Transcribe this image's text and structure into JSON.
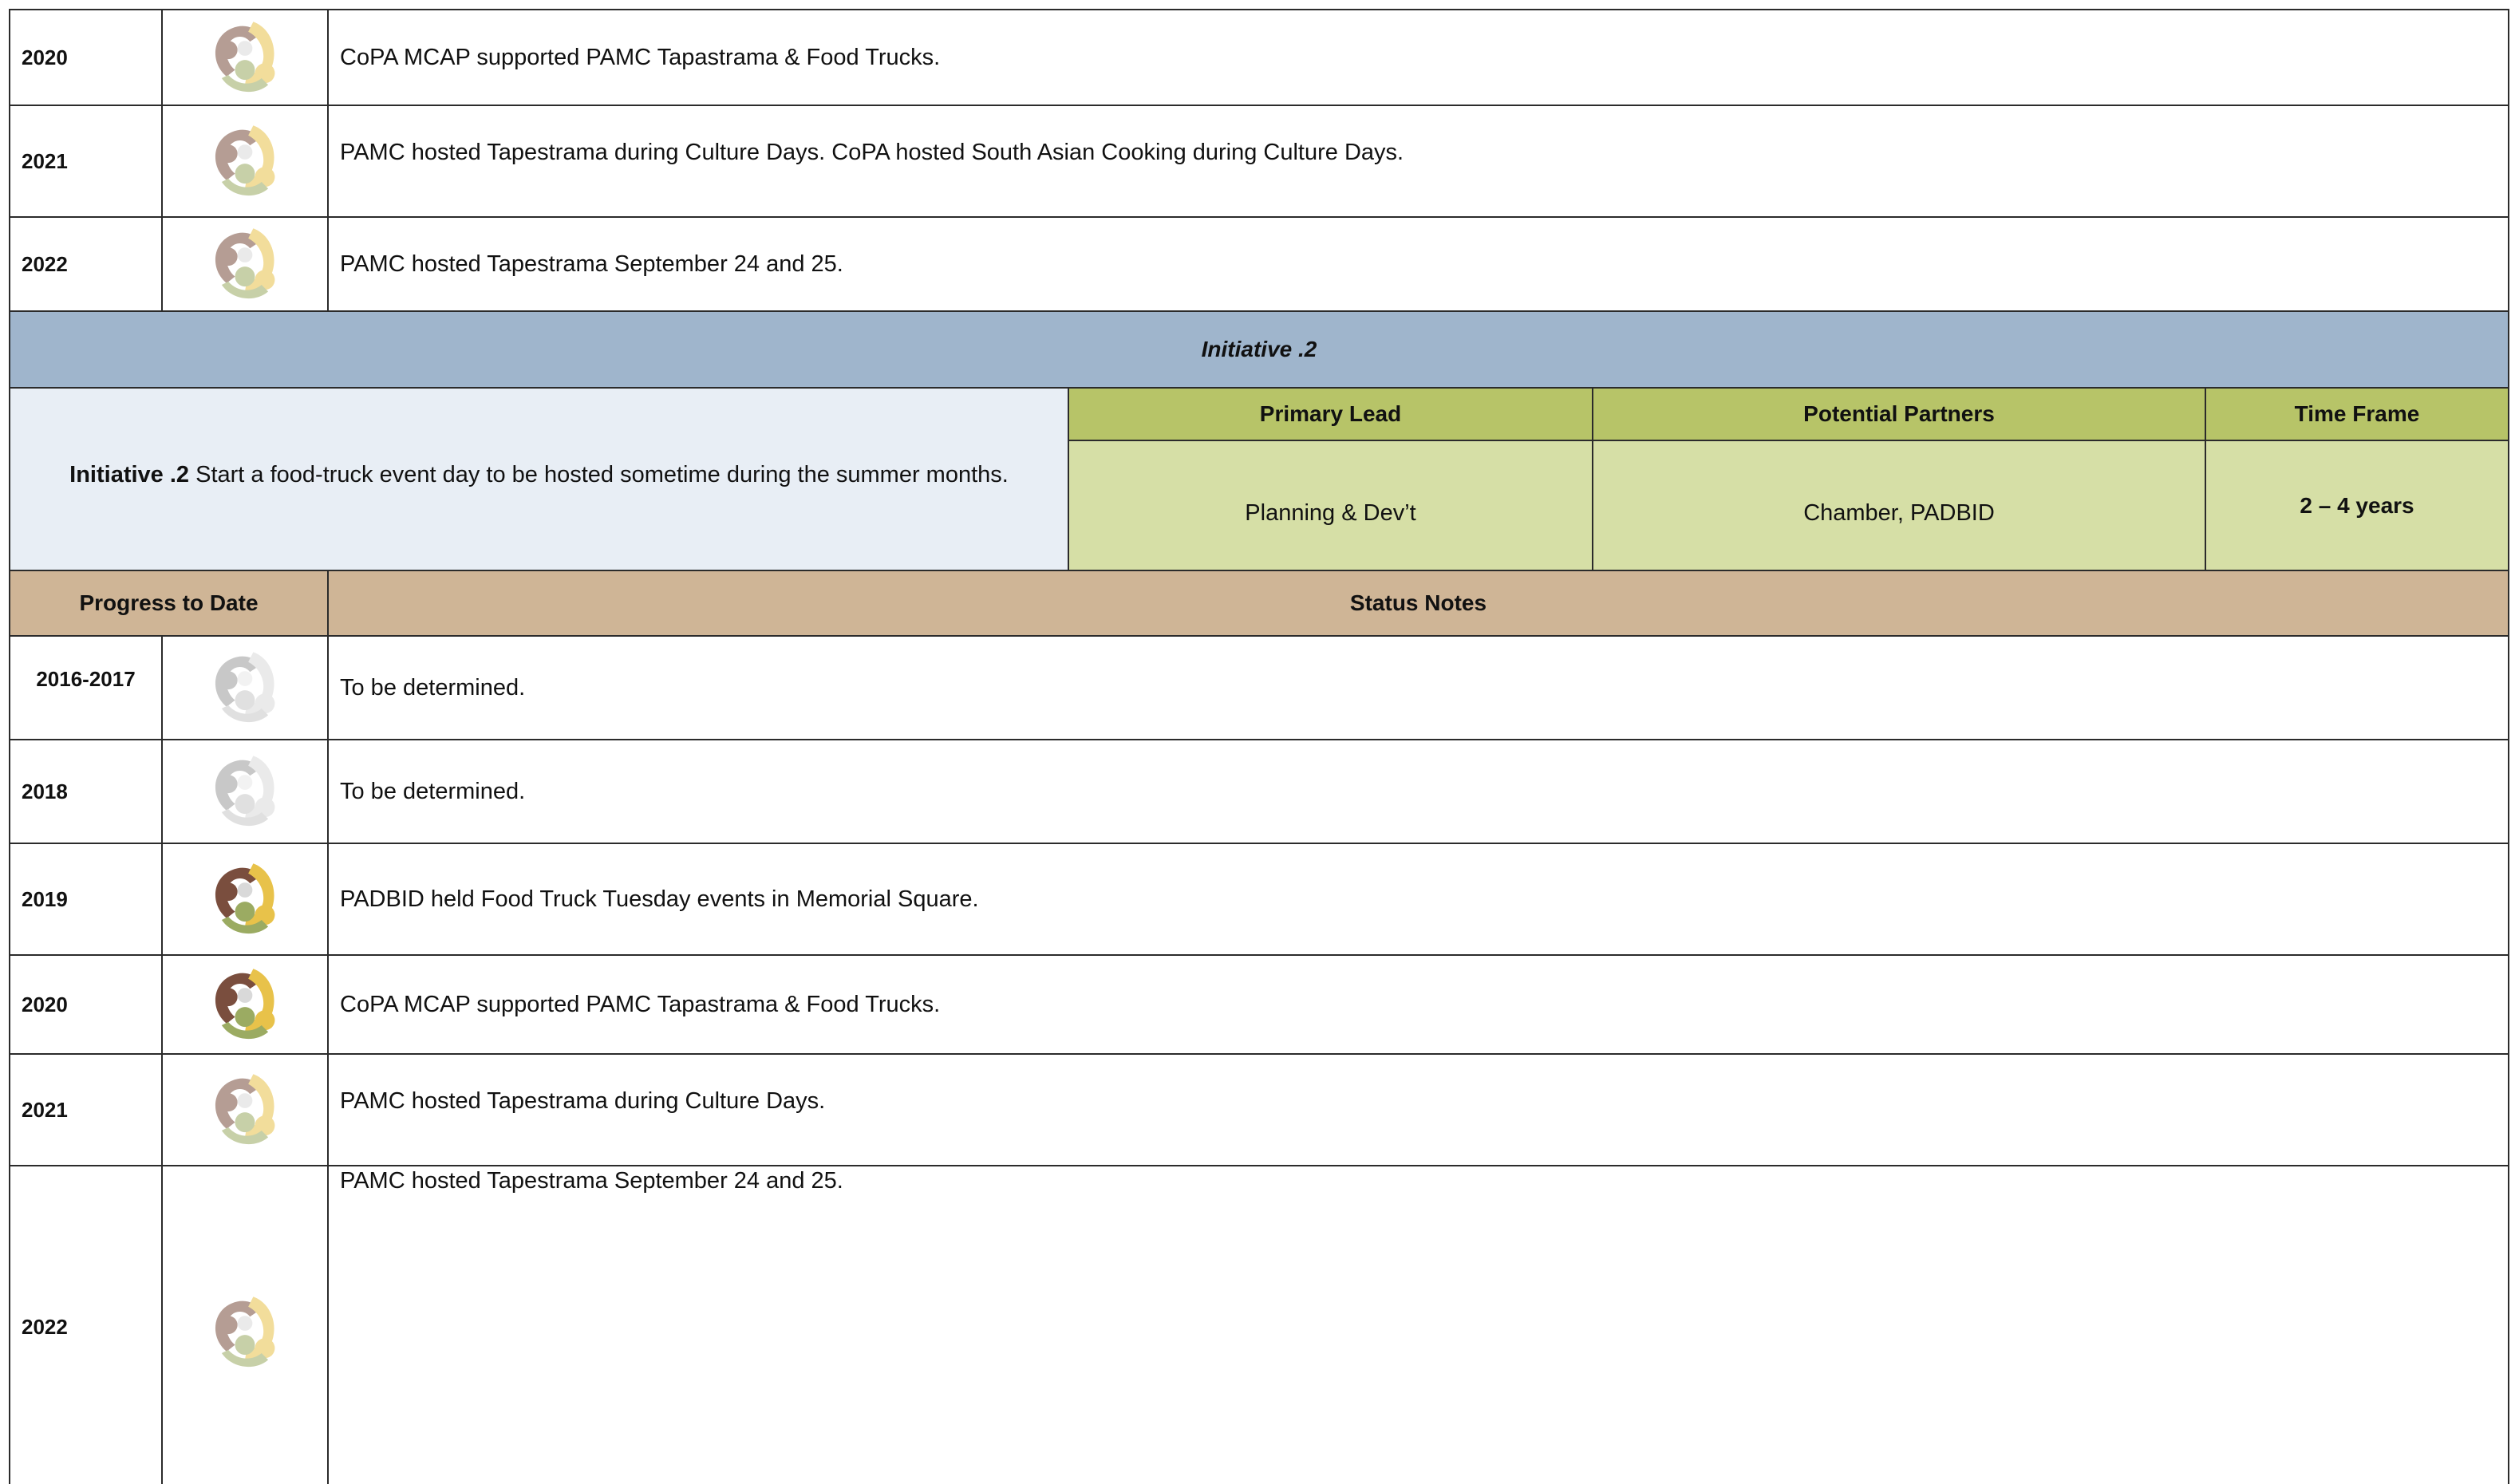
{
  "colors": {
    "initiative_bar": "#9fb5cc",
    "initiative_box": "#e8eef5",
    "green_header": "#b7c468",
    "green_cell": "#d6dfa6",
    "tan_header": "#cfb596",
    "border": "#2b2b2b"
  },
  "icons": {
    "progress": "progress-logo-icon"
  },
  "top_rows": [
    {
      "year": "2020",
      "note": "CoPA MCAP supported PAMC Tapastrama & Food Trucks."
    },
    {
      "year": "2021",
      "note": "PAMC hosted Tapestrama during Culture Days. CoPA hosted South Asian Cooking during Culture Days."
    },
    {
      "year": "2022",
      "note": "PAMC hosted Tapestrama September 24 and 25."
    }
  ],
  "initiative": {
    "bar_title": "Initiative .2",
    "label_bold": "Initiative .2",
    "description": " Start a food-truck event day to be hosted sometime during the summer months.",
    "headers": {
      "primary_lead": "Primary Lead",
      "potential_partners": "Potential Partners",
      "time_frame": "Time Frame"
    },
    "values": {
      "primary_lead": "Planning & Dev’t",
      "potential_partners": "Chamber, PADBID",
      "time_frame": "2 – 4 years"
    }
  },
  "progress_header": {
    "progress": "Progress to Date",
    "status": "Status Notes"
  },
  "bottom_rows": [
    {
      "year": "2016-2017",
      "note": "To be determined."
    },
    {
      "year": "2018",
      "note": "To be determined."
    },
    {
      "year": "2019",
      "note": "PADBID held Food Truck Tuesday events in Memorial Square."
    },
    {
      "year": "2020",
      "note": "CoPA MCAP supported PAMC Tapastrama & Food Trucks."
    },
    {
      "year": "2021",
      "note": "PAMC hosted Tapestrama during Culture Days."
    },
    {
      "year": "2022",
      "note": "PAMC hosted Tapestrama September 24 and 25."
    }
  ]
}
